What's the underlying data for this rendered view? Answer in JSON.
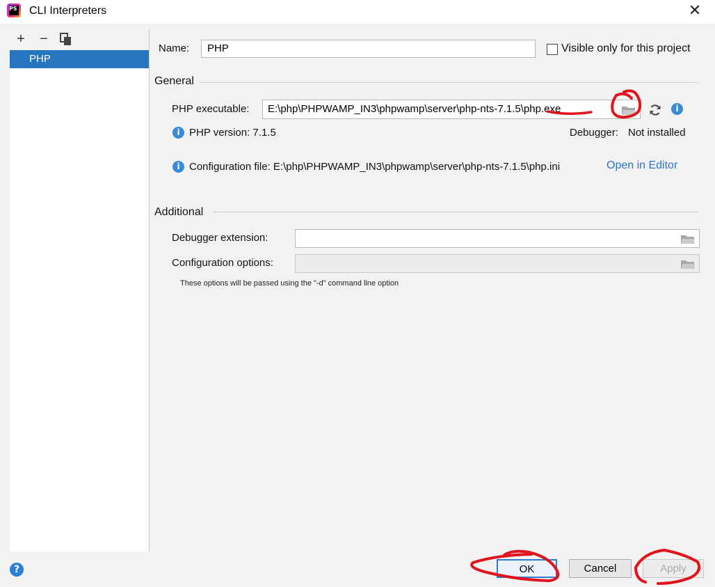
{
  "window": {
    "title": "CLI Interpreters",
    "app_icon_text": "PS"
  },
  "left_panel": {
    "toolbar": {
      "add": "+",
      "remove": "−"
    },
    "items": [
      {
        "label": "PHP",
        "selected": true
      }
    ]
  },
  "form": {
    "name_label": "Name:",
    "name_value": "PHP",
    "visible_only_label": "Visible only for this project",
    "visible_only_checked": false,
    "general_title": "General",
    "php_executable_label": "PHP executable:",
    "php_executable_value": "E:\\php\\PHPWAMP_IN3\\phpwamp\\server\\php-nts-7.1.5\\php.exe",
    "php_version_text": "PHP version: 7.1.5",
    "debugger_label": "Debugger:",
    "debugger_value": "Not installed",
    "config_file_text": "Configuration file: E:\\php\\PHPWAMP_IN3\\phpwamp\\server\\php-nts-7.1.5\\php.ini",
    "open_in_editor": "Open in Editor",
    "additional_title": "Additional",
    "debugger_extension_label": "Debugger extension:",
    "debugger_extension_value": "",
    "configuration_options_label": "Configuration options:",
    "configuration_options_value": "",
    "configuration_options_hint": "These options will be passed using the \"-d\" command line option"
  },
  "buttons": {
    "ok": "OK",
    "cancel": "Cancel",
    "apply": "Apply",
    "help": "?"
  },
  "colors": {
    "selection": "#2675bf",
    "link": "#2f73c6",
    "annotation": "#e0141c"
  }
}
